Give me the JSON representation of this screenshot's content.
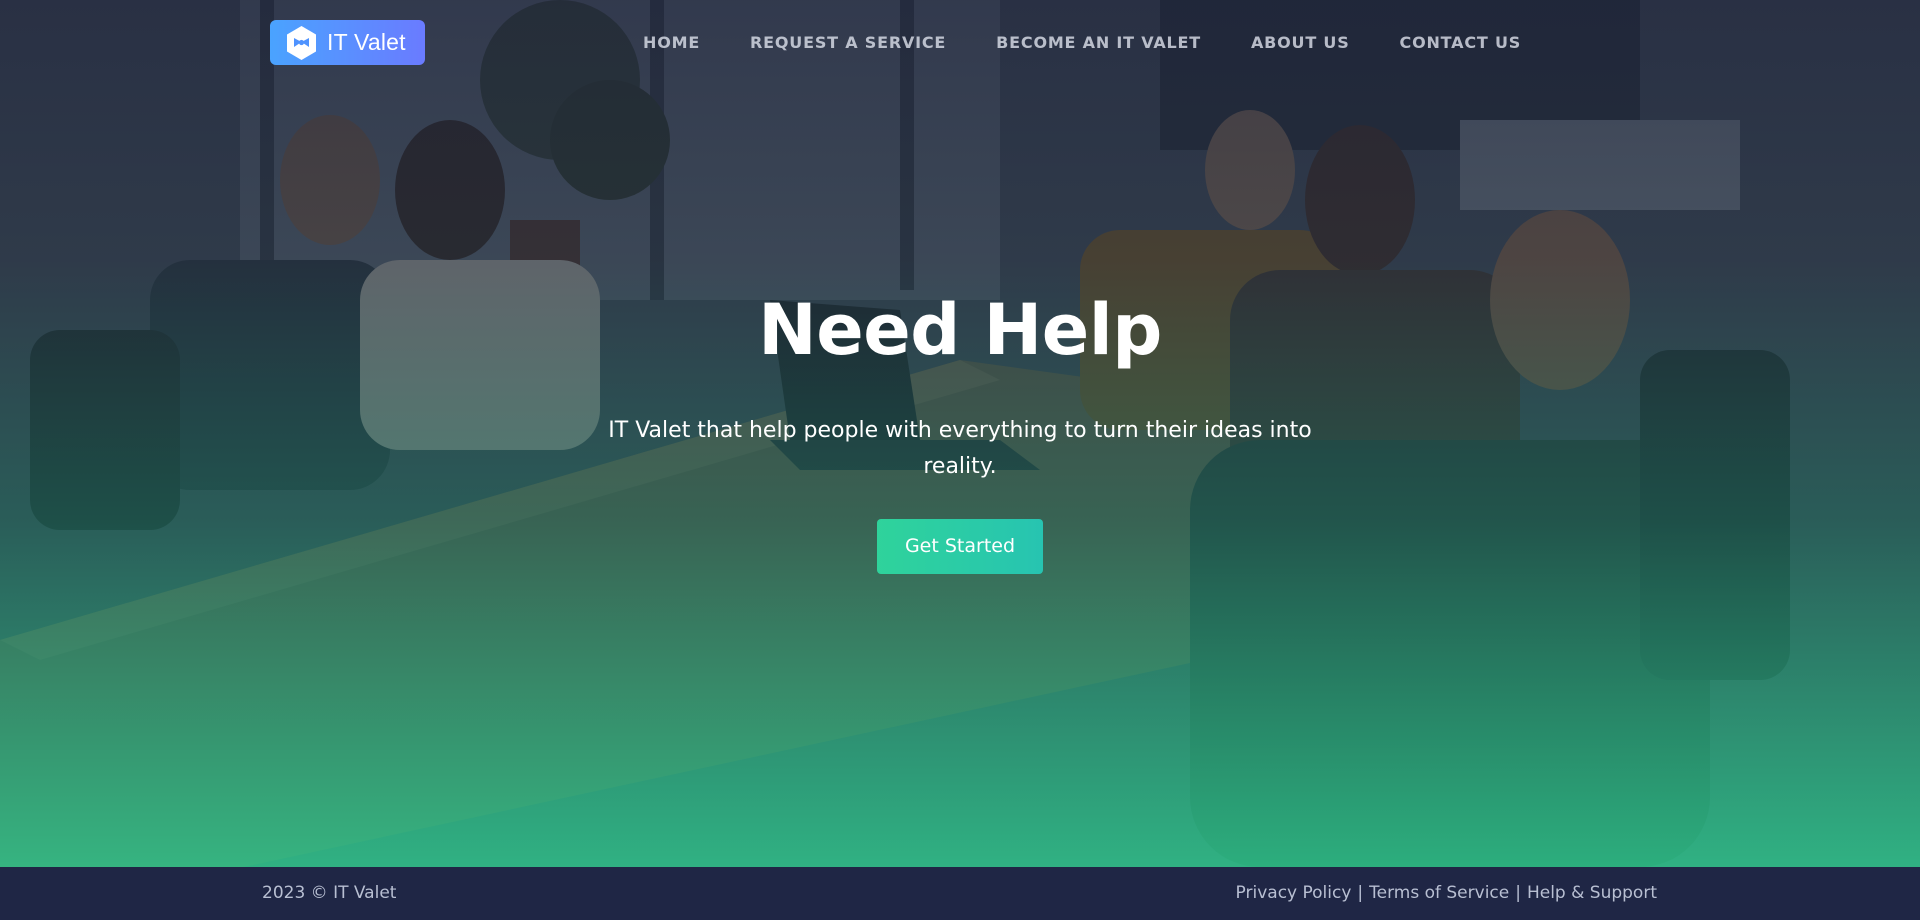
{
  "brand": {
    "name": "IT Valet",
    "logo_icon": "hexagon-bowtie-icon",
    "logo_color_start": "#4aa3ff",
    "logo_color_end": "#6a7bff"
  },
  "nav": {
    "items": [
      {
        "label": "HOME"
      },
      {
        "label": "REQUEST A SERVICE"
      },
      {
        "label": "BECOME AN IT VALET"
      },
      {
        "label": "ABOUT US"
      },
      {
        "label": "CONTACT US"
      }
    ]
  },
  "hero": {
    "title": "Need Help",
    "subtitle": "IT Valet that help people with everything to turn their ideas into reality.",
    "cta_label": "Get Started",
    "cta_color": "#2fd39b",
    "overlay_color_bottom": "#2cbe87"
  },
  "footer": {
    "copyright": "2023 © IT Valet",
    "links": [
      {
        "label": "Privacy Policy"
      },
      {
        "label": "Terms of Service"
      },
      {
        "label": "Help & Support"
      }
    ],
    "separator": "|",
    "background": "#1f2645"
  }
}
